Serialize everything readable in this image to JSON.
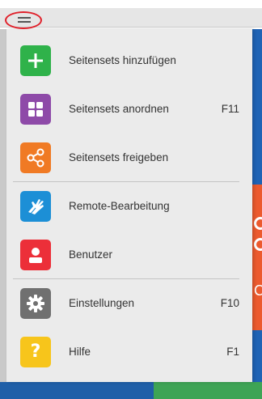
{
  "menu": {
    "items": [
      {
        "label": "Seitensets hinzufügen",
        "shortcut": "",
        "icon": "plus-icon",
        "color": "#2fb24a"
      },
      {
        "label": "Seitensets anordnen",
        "shortcut": "F11",
        "icon": "grid-icon",
        "color": "#8e4aa8"
      },
      {
        "label": "Seitensets freigeben",
        "shortcut": "",
        "icon": "share-icon",
        "color": "#f07a24"
      },
      {
        "label": "Remote-Bearbeitung",
        "shortcut": "",
        "icon": "hand-icon",
        "color": "#1c8fd6"
      },
      {
        "label": "Benutzer",
        "shortcut": "",
        "icon": "user-icon",
        "color": "#ec2f39"
      },
      {
        "label": "Einstellungen",
        "shortcut": "F10",
        "icon": "gear-icon",
        "color": "#707070"
      },
      {
        "label": "Hilfe",
        "shortcut": "F1",
        "icon": "help-icon",
        "color": "#f7c51b"
      }
    ]
  },
  "background": {
    "glyph": "C"
  },
  "colors": {
    "drawer": "#ebebeb",
    "annotation": "#e0202a",
    "app_blue": "#1f63b5",
    "app_green": "#3ea455",
    "app_orange": "#ec5a2e"
  }
}
